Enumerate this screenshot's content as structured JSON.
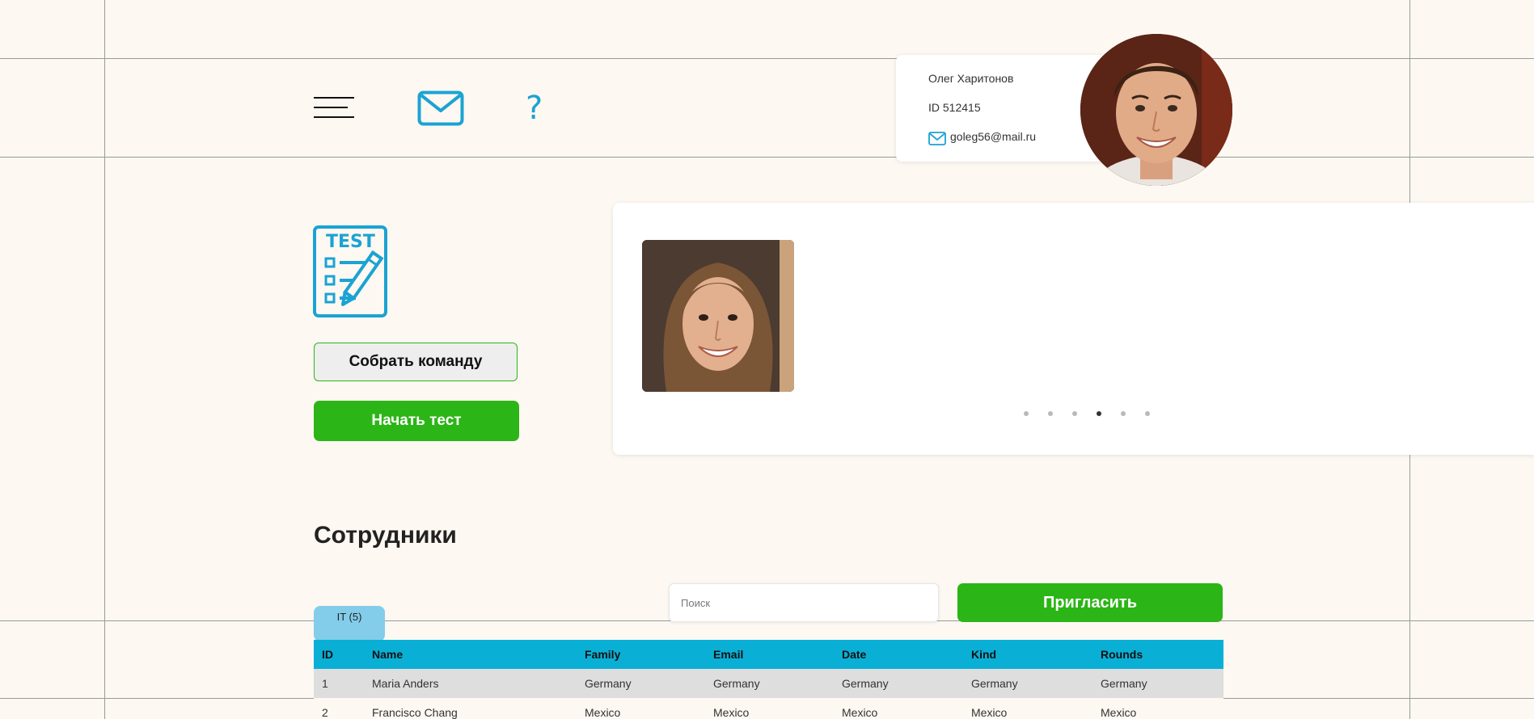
{
  "header": {
    "menu_icon": "hamburger-menu-icon",
    "mail_icon": "envelope-icon",
    "help_label": "?"
  },
  "profile": {
    "name": "Олег Харитонов",
    "id_text": "ID 512415",
    "email": "goleg56@mail.ru"
  },
  "actions": {
    "test_icon": "test-checklist-icon",
    "build_team_label": "Собрать команду",
    "start_test_label": "Начать тест"
  },
  "carousel": {
    "dots_count": 6,
    "active_index": 3
  },
  "employees": {
    "title": "Сотрудники",
    "search_placeholder": "Поиск",
    "invite_label": "Пригласить",
    "tab_label": "IT (5)",
    "columns": [
      "ID",
      "Name",
      "Family",
      "Email",
      "Date",
      "Kind",
      "Rounds"
    ],
    "rows": [
      [
        "1",
        "Maria Anders",
        "Germany",
        "Germany",
        "Germany",
        "Germany",
        "Germany"
      ],
      [
        "2",
        "Francisco Chang",
        "Mexico",
        "Mexico",
        "Mexico",
        "Mexico",
        "Mexico"
      ]
    ]
  },
  "colors": {
    "accent_blue": "#1ba3d3",
    "table_header": "#0aafd6",
    "green": "#2bb516",
    "tab": "#83cdea",
    "background": "#fdf8f2"
  }
}
